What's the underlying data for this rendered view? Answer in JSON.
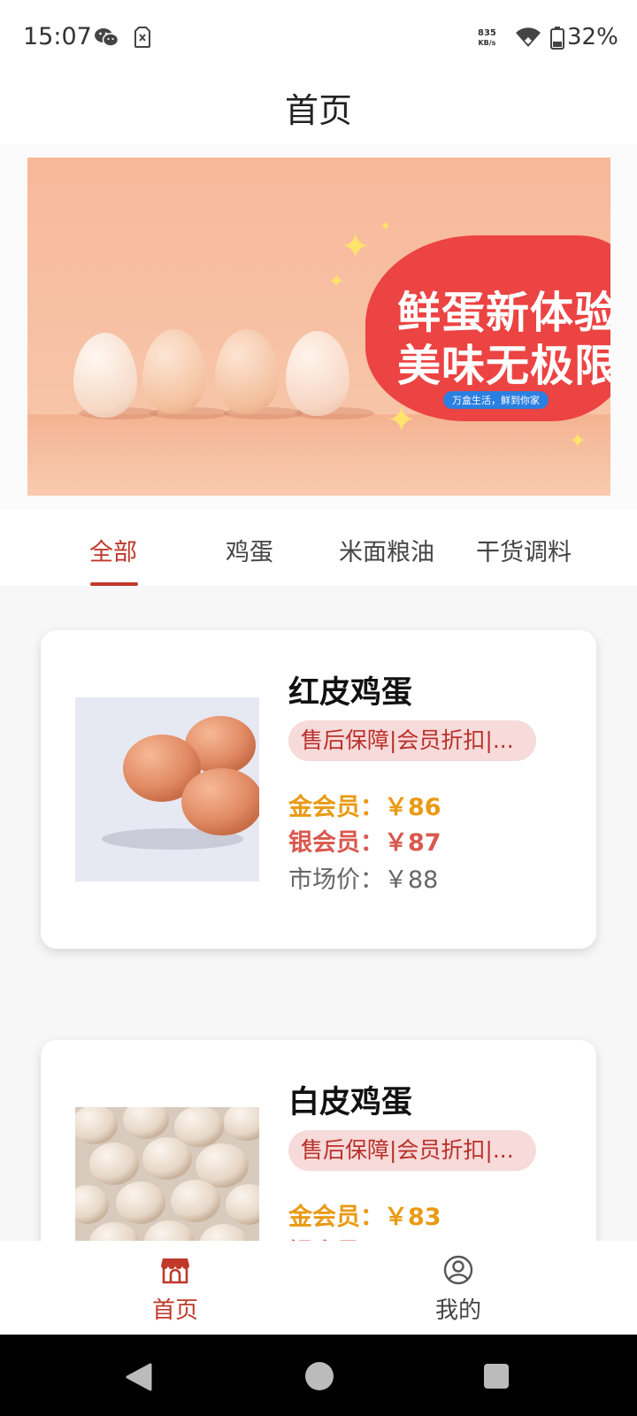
{
  "status_bar": {
    "time": "15:07",
    "net_speed_value": "835",
    "net_speed_unit": "KB/s",
    "battery_percent": "32%",
    "icons": [
      "wechat-icon",
      "sim-error-icon",
      "wifi-icon",
      "battery-icon"
    ]
  },
  "header": {
    "title": "首页"
  },
  "banner": {
    "headline_line1": "鲜蛋新体验",
    "headline_line2": "美味无极限",
    "slogan": "万盒生活，鲜到你家"
  },
  "tabs": [
    {
      "label": "全部",
      "active": true
    },
    {
      "label": "鸡蛋",
      "active": false
    },
    {
      "label": "米面粮油",
      "active": false
    },
    {
      "label": "干货调料",
      "active": false
    }
  ],
  "products": [
    {
      "name": "红皮鸡蛋",
      "tags": "售后保障|会员折扣|...",
      "gold_price": "金会员：￥86",
      "silver_price": "银会员：￥87",
      "market_price": "市场价：￥88"
    },
    {
      "name": "白皮鸡蛋",
      "tags": "售后保障|会员折扣|...",
      "gold_price": "金会员：￥83",
      "silver_price": "银会员：",
      "market_price": ""
    }
  ],
  "bottom_nav": [
    {
      "label": "首页",
      "icon": "store-icon",
      "active": true
    },
    {
      "label": "我的",
      "icon": "user-icon",
      "active": false
    }
  ],
  "colors": {
    "accent": "#c0392b",
    "gold_price": "#e99a14",
    "silver_price": "#d9584e",
    "tag_bg": "#f7dada",
    "banner_red": "#ec4343"
  }
}
